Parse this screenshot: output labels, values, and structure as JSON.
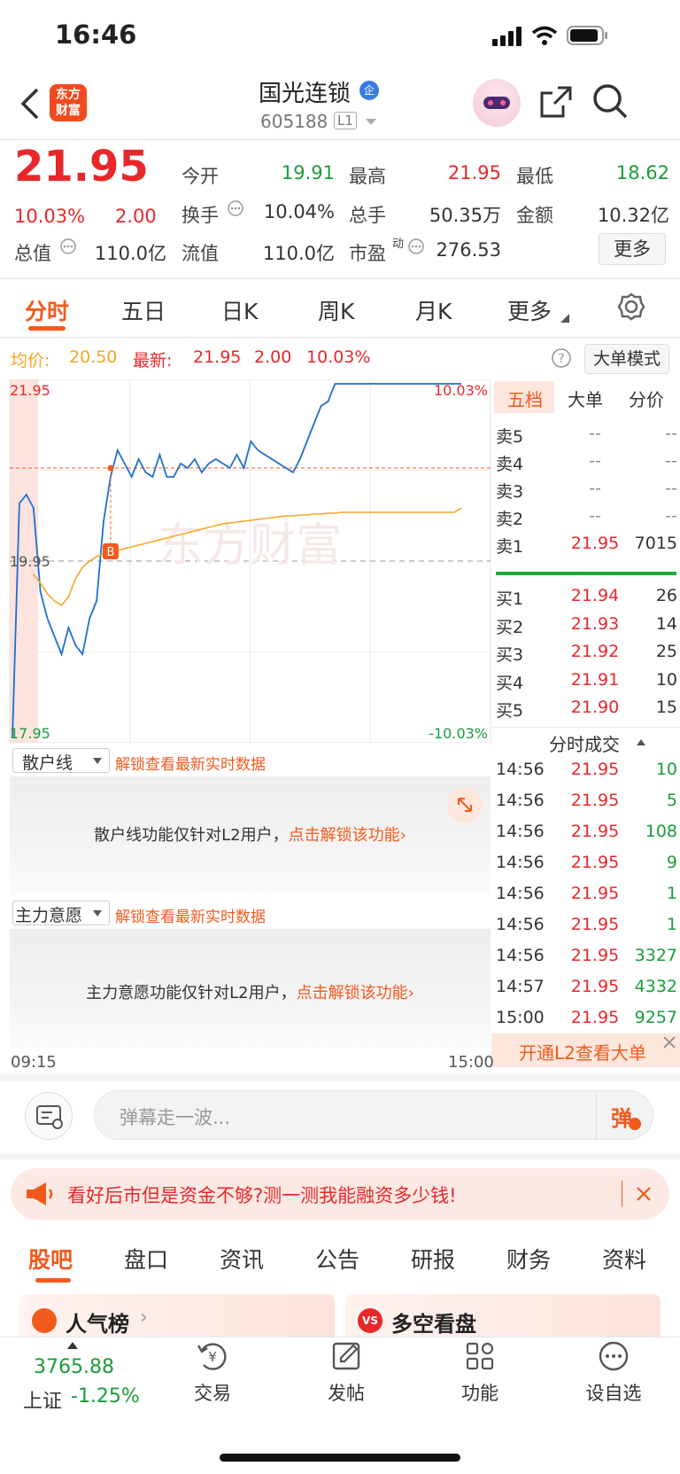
{
  "status": {
    "time": "16:46"
  },
  "nav": {
    "logo_line1": "东方",
    "logo_line2": "财富",
    "stock_name": "国光连锁",
    "verify_badge": "企",
    "stock_code": "605188",
    "level": "L1"
  },
  "quote": {
    "price": "21.95",
    "pct": "10.03%",
    "change": "2.00",
    "open_label": "今开",
    "open": "19.91",
    "high_label": "最高",
    "high": "21.95",
    "low_label": "最低",
    "low": "18.62",
    "turnover_label": "换手",
    "turnover": "10.04%",
    "volume_label": "总手",
    "volume": "50.35万",
    "amount_label": "金额",
    "amount": "10.32亿",
    "mktcap_label": "总值",
    "mktcap": "110.0亿",
    "float_label": "流值",
    "float": "110.0亿",
    "pe_label": "市盈",
    "pe_sup": "动",
    "pe": "276.53",
    "more_button": "更多"
  },
  "chart_tabs": [
    "分时",
    "五日",
    "日K",
    "周K",
    "月K",
    "更多"
  ],
  "chart_info": {
    "avg_label": "均价:",
    "avg": "20.50",
    "last_label": "最新:",
    "last": "21.95",
    "change": "2.00",
    "pct": "10.03%",
    "big_order_button": "大单模式"
  },
  "chart_data": {
    "type": "line",
    "ylim": [
      17.95,
      21.95
    ],
    "y_ticks": [
      "21.95",
      "19.95",
      "17.95"
    ],
    "right_ticks": [
      "10.03%",
      "-10.03%"
    ],
    "x_labels": [
      "09:15",
      "15:00"
    ],
    "watermark": "东方财富",
    "buy_marker": "B",
    "series": [
      {
        "values": [
          17.95,
          20.6,
          20.7,
          20.55,
          19.6,
          19.3,
          19.1,
          18.9,
          19.2,
          19.0,
          18.9,
          19.3,
          19.5,
          20.4,
          20.9,
          21.2,
          21.05,
          20.9,
          21.1,
          20.95,
          20.9,
          21.15,
          20.9,
          20.9,
          21.05,
          21.0,
          21.1,
          20.95,
          21.05,
          21.1,
          21.05,
          21.0,
          21.15,
          21.0,
          21.3,
          21.2,
          21.15,
          21.1,
          21.05,
          21.0,
          20.95,
          21.1,
          21.3,
          21.5,
          21.7,
          21.75,
          21.95,
          21.95,
          21.95,
          21.95,
          21.95,
          21.95,
          21.95,
          21.95,
          21.95,
          21.95,
          21.95,
          21.95,
          21.95,
          21.95,
          21.95,
          21.95,
          21.95,
          21.95,
          21.95
        ]
      },
      {
        "values": [
          null,
          null,
          null,
          19.8,
          19.7,
          19.58,
          19.5,
          19.45,
          19.55,
          19.75,
          19.88,
          19.95,
          20.0,
          20.03,
          20.05,
          20.07,
          20.09,
          20.11,
          20.13,
          20.15,
          20.17,
          20.19,
          20.21,
          20.23,
          20.25,
          20.27,
          20.29,
          20.31,
          20.33,
          20.35,
          20.37,
          20.38,
          20.39,
          20.4,
          20.41,
          20.42,
          20.43,
          20.44,
          20.45,
          20.46,
          20.46,
          20.47,
          20.47,
          20.48,
          20.48,
          20.49,
          20.49,
          20.5,
          20.5,
          20.5,
          20.5,
          20.5,
          20.5,
          20.5,
          20.5,
          20.5,
          20.5,
          20.5,
          20.5,
          20.5,
          20.5,
          20.5,
          20.5,
          20.5,
          20.55
        ]
      }
    ]
  },
  "orderbook": {
    "tabs": [
      "五档",
      "大单",
      "分价"
    ],
    "asks": [
      {
        "label": "卖5",
        "price": "--",
        "vol": "--"
      },
      {
        "label": "卖4",
        "price": "--",
        "vol": "--"
      },
      {
        "label": "卖3",
        "price": "--",
        "vol": "--"
      },
      {
        "label": "卖2",
        "price": "--",
        "vol": "--"
      },
      {
        "label": "卖1",
        "price": "21.95",
        "vol": "7015"
      }
    ],
    "bids": [
      {
        "label": "买1",
        "price": "21.94",
        "vol": "26"
      },
      {
        "label": "买2",
        "price": "21.93",
        "vol": "14"
      },
      {
        "label": "买3",
        "price": "21.92",
        "vol": "25"
      },
      {
        "label": "买4",
        "price": "21.91",
        "vol": "10"
      },
      {
        "label": "买5",
        "price": "21.90",
        "vol": "15"
      }
    ],
    "trades_title": "分时成交",
    "trades": [
      {
        "t": "14:56",
        "p": "21.95",
        "v": "10"
      },
      {
        "t": "14:56",
        "p": "21.95",
        "v": "5"
      },
      {
        "t": "14:56",
        "p": "21.95",
        "v": "108"
      },
      {
        "t": "14:56",
        "p": "21.95",
        "v": "9"
      },
      {
        "t": "14:56",
        "p": "21.95",
        "v": "1"
      },
      {
        "t": "14:56",
        "p": "21.95",
        "v": "1"
      },
      {
        "t": "14:56",
        "p": "21.95",
        "v": "3327"
      },
      {
        "t": "14:57",
        "p": "21.95",
        "v": "4332"
      },
      {
        "t": "15:00",
        "p": "21.95",
        "v": "9257"
      }
    ],
    "l2_banner": "开通L2查看大单"
  },
  "retail": {
    "dropdown": "散户线",
    "unlock": "解锁查看最新实时数据",
    "msg": "散户线功能仅针对L2用户，",
    "link": "点击解锁该功能"
  },
  "main_force": {
    "dropdown": "主力意愿",
    "unlock": "解锁查看最新实时数据",
    "msg": "主力意愿功能仅针对L2用户，",
    "link": "点击解锁该功能"
  },
  "danmu": {
    "placeholder": "弹幕走一波...",
    "send": "弹"
  },
  "promo": {
    "text": "看好后市但是资金不够?测一测我能融资多少钱!"
  },
  "forum_tabs": [
    "股吧",
    "盘口",
    "资讯",
    "公告",
    "研报",
    "财务",
    "资料"
  ],
  "cards": {
    "popular": "人气榜",
    "longshort": "多空看盘"
  },
  "bottom_nav": {
    "index_value": "3765.88",
    "index_name": "上证",
    "index_pct": "-1.25%",
    "trade": "交易",
    "post": "发帖",
    "func": "功能",
    "watch": "设自选"
  },
  "colors": {
    "up": "#e8272b",
    "down": "#1a9c3a",
    "accent": "#f25a1c",
    "avg_line": "#f5a623",
    "price_line": "#1f6fd1"
  }
}
